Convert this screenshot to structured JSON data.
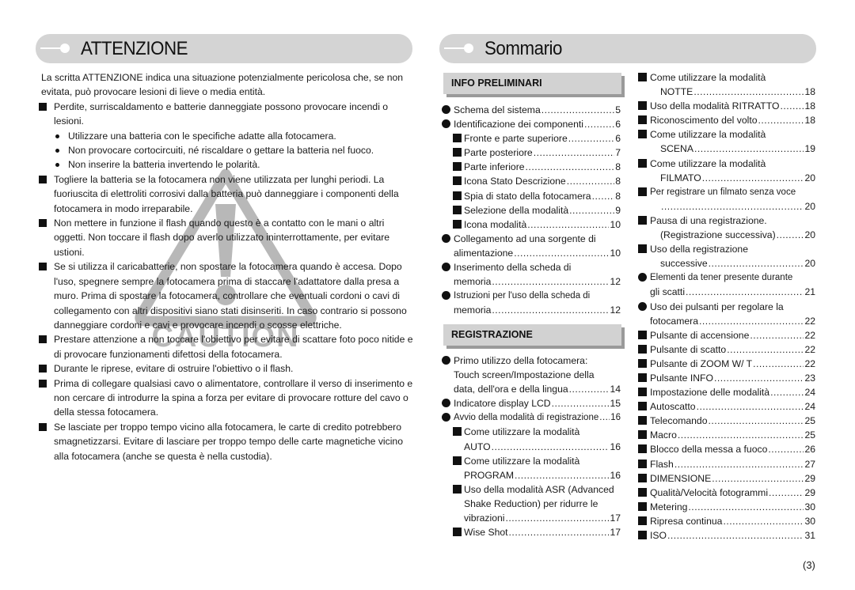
{
  "left": {
    "header_title": "ATTENZIONE",
    "intro": "La scritta ATTENZIONE indica una situazione potenzialmente pericolosa che, se non evitata, può provocare lesioni di lieve o media entità.",
    "blocks": [
      {
        "text": "Perdite, surriscaldamento e batterie danneggiate possono provocare incendi o lesioni.",
        "bullets": [
          "Utilizzare una batteria con le specifiche adatte alla fotocamera.",
          "Non provocare cortocircuiti, né riscaldare o gettare la batteria nel fuoco.",
          "Non inserire la batteria invertendo le polarità."
        ]
      },
      {
        "text": "Togliere la batteria se la fotocamera non viene utilizzata per lunghi periodi. La fuoriuscita di elettroliti corrosivi dalla batteria può danneggiare i componenti della fotocamera in modo irreparabile."
      },
      {
        "text": "Non mettere in funzione il flash quando questo è a contatto con le mani o altri oggetti. Non toccare il flash dopo averlo utilizzato ininterrottamente, per evitare ustioni."
      },
      {
        "text": "Se si utilizza il caricabatterie, non spostare la fotocamera quando è accesa. Dopo l'uso, spegnere sempre la fotocamera prima di staccare l'adattatore dalla presa a muro. Prima di spostare la fotocamera, controllare che eventuali cordoni o cavi di collegamento con altri dispositivi siano stati disinseriti. In caso contrario si possono danneggiare cordoni e cavi e provocare incendi o scosse elettriche."
      },
      {
        "text": "Prestare attenzione a non toccare l'obiettivo per evitare di scattare foto poco nitide e di provocare funzionamenti difettosi della fotocamera."
      },
      {
        "text": "Durante le riprese, evitare di ostruire l'obiettivo o il flash."
      },
      {
        "text": "Prima di collegare qualsiasi cavo o alimentatore, controllare il verso di inserimento e non cercare di introdurre la spina a forza per evitare di provocare rotture del cavo o della stessa fotocamera."
      },
      {
        "text": "Se lasciate per troppo tempo vicino alla fotocamera, le carte di credito potrebbero smagnetizzarsi. Evitare di lasciare per troppo tempo delle carte magnetiche vicino alla fotocamera (anche se questa è nella custodia)."
      }
    ],
    "watermark_text": "CAUTION",
    "watermark_icon": "warning-triangle-icon"
  },
  "right": {
    "header_title": "Sommario",
    "categories": {
      "info": "INFO PRELIMINARI",
      "reg": "REGISTRAZIONE"
    },
    "info_items": [
      {
        "level": 1,
        "text": "Schema del sistema",
        "page": "5"
      },
      {
        "level": 1,
        "text": "Identificazione dei componenti",
        "page": "6"
      },
      {
        "level": 2,
        "text": "Fronte e parte superiore",
        "page": "6"
      },
      {
        "level": 2,
        "text": "Parte posteriore",
        "page": "7"
      },
      {
        "level": 2,
        "text": "Parte inferiore",
        "page": "8"
      },
      {
        "level": 2,
        "text": "Icona  Stato  Descrizione",
        "page": "8"
      },
      {
        "level": 2,
        "text": "Spia di stato della fotocamera",
        "page": "8"
      },
      {
        "level": 2,
        "text": "Selezione della modalità",
        "page": "9"
      },
      {
        "level": 2,
        "text": "Icona modalità",
        "page": "10"
      },
      {
        "level": 1,
        "text": "Collegamento ad una sorgente di",
        "cont": "alimentazione",
        "page": "10"
      },
      {
        "level": 1,
        "text": "Inserimento della scheda di",
        "cont": "memoria",
        "page": "12"
      },
      {
        "level": 1,
        "text": "Istruzioni per l'uso della scheda di",
        "cont": "memoria",
        "page": "12"
      }
    ],
    "reg_items": [
      {
        "level": 1,
        "text": "Primo utilizzo della fotocamera:",
        "cont": "Touch screen/Impostazione della",
        "cont2": "data, dell'ora e della lingua",
        "page": "14"
      },
      {
        "level": 1,
        "text": "Indicatore display LCD",
        "page": "15"
      },
      {
        "level": 1,
        "text": "Avvio della modalità di registrazione",
        "page": "16"
      },
      {
        "level": 2,
        "text": "Come utilizzare la modalità",
        "cont": "AUTO",
        "page": "16"
      },
      {
        "level": 2,
        "text": "Come utilizzare la modalità",
        "cont": "PROGRAM",
        "page": "16"
      },
      {
        "level": 2,
        "text": "Uso della modalità ASR (Advanced",
        "cont": "Shake Reduction) per ridurre le",
        "cont2": "vibrazioni",
        "page": "17"
      },
      {
        "level": 2,
        "text": "Wise Shot",
        "page": "17"
      }
    ],
    "col3_items": [
      {
        "level": 2,
        "text": "Come utilizzare la modalità",
        "cont": "NOTTE",
        "page": "18"
      },
      {
        "level": 2,
        "text": "Uso della modalità RITRATTO",
        "page": "18"
      },
      {
        "level": 2,
        "text": "Riconoscimento del volto",
        "page": "18"
      },
      {
        "level": 2,
        "text": "Come utilizzare la modalità",
        "cont": "SCENA",
        "page": "19"
      },
      {
        "level": 2,
        "text": "Come utilizzare la modalità",
        "cont": "FILMATO",
        "page": "20"
      },
      {
        "level": 2,
        "text": "Per registrare un filmato senza voce",
        "cont": "",
        "page": "20"
      },
      {
        "level": 2,
        "text": "Pausa di una registrazione.",
        "cont": "(Registrazione successiva)",
        "page": "20"
      },
      {
        "level": 2,
        "text": "Uso della registrazione",
        "cont": "successive",
        "page": "20"
      },
      {
        "level": 1,
        "text": "Elementi da tener presente durante",
        "cont": "gli scatti",
        "page": "21"
      },
      {
        "level": 1,
        "text": "Uso dei pulsanti per regolare la",
        "cont": "fotocamera",
        "page": "22"
      },
      {
        "level": 2,
        "text": "Pulsante di accensione",
        "page": "22"
      },
      {
        "level": 2,
        "text": "Pulsante di scatto",
        "page": "22"
      },
      {
        "level": 2,
        "text": "Pulsante di ZOOM W/ T",
        "page": "22"
      },
      {
        "level": 2,
        "text": "Pulsante INFO",
        "page": "23"
      },
      {
        "level": 2,
        "text": " Impostazione delle modalità",
        "page": "24"
      },
      {
        "level": 2,
        "text": "Autoscatto",
        "page": "24"
      },
      {
        "level": 2,
        "text": "Telecomando",
        "page": "25"
      },
      {
        "level": 2,
        "text": "Macro",
        "page": "25"
      },
      {
        "level": 2,
        "text": "Blocco della messa a fuoco",
        "page": "26"
      },
      {
        "level": 2,
        "text": "Flash",
        "page": "27"
      },
      {
        "level": 2,
        "text": "DIMENSIONE",
        "page": "29"
      },
      {
        "level": 2,
        "text": "Qualità/Velocità fotogrammi",
        "page": "29"
      },
      {
        "level": 2,
        "text": "Metering",
        "page": "30"
      },
      {
        "level": 2,
        "text": "Ripresa continua",
        "page": "30"
      },
      {
        "level": 2,
        "text": "ISO",
        "page": "31"
      }
    ]
  },
  "page_number": "(3)",
  "colors": {
    "header_bg": "#d4d4d4",
    "category_bg": "#d2d2d2",
    "category_shadow": "#9a9a9a",
    "watermark": "#b8b8b8"
  }
}
